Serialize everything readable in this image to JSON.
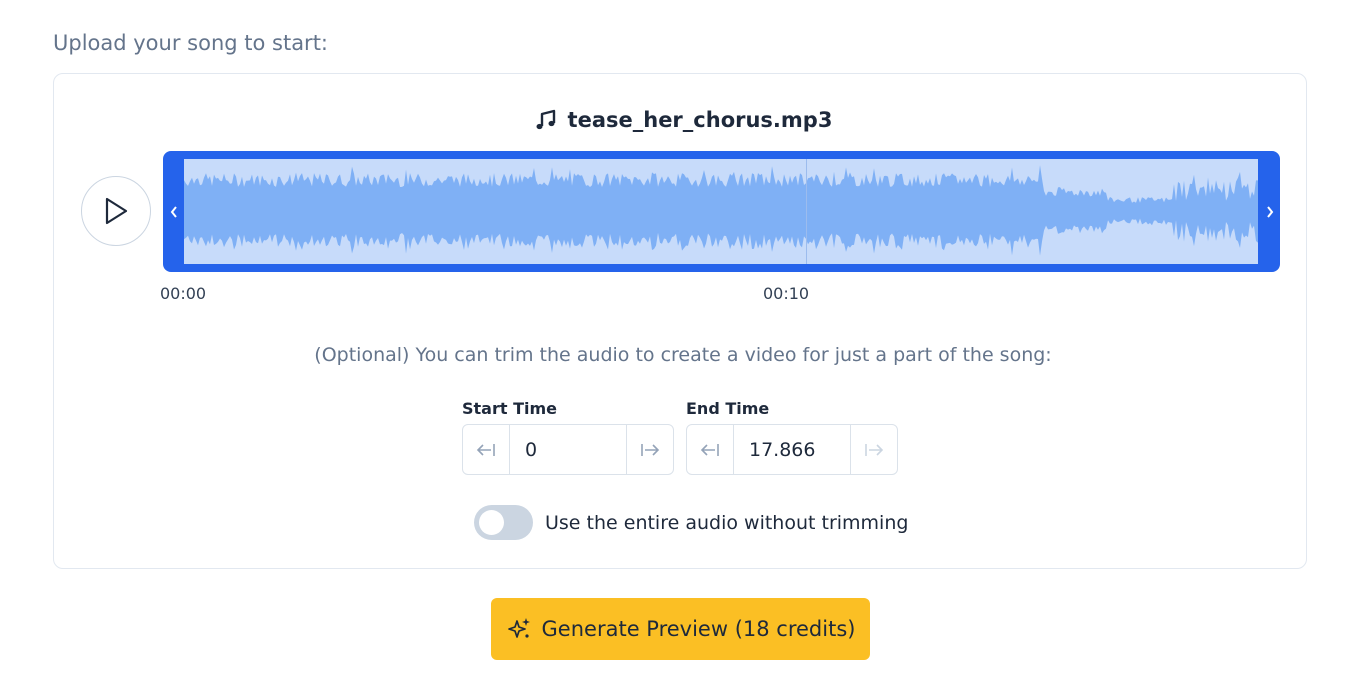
{
  "intro": {
    "text": "Upload your song to start:"
  },
  "player": {
    "filename": "tease_her_chorus.mp3",
    "ticks": [
      "00:00",
      "00:10"
    ]
  },
  "trim": {
    "note": "(Optional) You can trim the audio to create a video for just a part of the song:",
    "start": {
      "label": "Start Time",
      "value": "0"
    },
    "end": {
      "label": "End Time",
      "value": "17.866"
    },
    "toggle_label": "Use the entire audio without trimming",
    "toggle_on": false
  },
  "generate": {
    "label": "Generate Preview (18 credits)"
  },
  "colors": {
    "accent": "#2563eb",
    "waveform": "#7fb0f5",
    "wave_background": "#c7dbfa",
    "button": "#fbbf24"
  }
}
